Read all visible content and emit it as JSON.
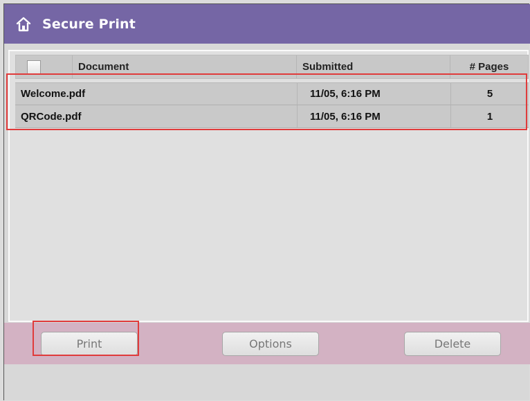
{
  "window": {
    "title": "Secure Print",
    "icon": "home-icon"
  },
  "table": {
    "columns": [
      "Document",
      "Submitted",
      "# Pages"
    ],
    "rows": [
      {
        "name": "Welcome.pdf",
        "submitted": "11/05, 6:16 PM",
        "pages": "5"
      },
      {
        "name": "QRCode.pdf",
        "submitted": "11/05, 6:16 PM",
        "pages": "1"
      }
    ]
  },
  "actions": {
    "print": "Print",
    "options": "Options",
    "delete": "Delete"
  },
  "colors": {
    "titlebar": "#7566a5",
    "actionbar": "#d3b2c3",
    "highlight": "#e03b3b"
  }
}
